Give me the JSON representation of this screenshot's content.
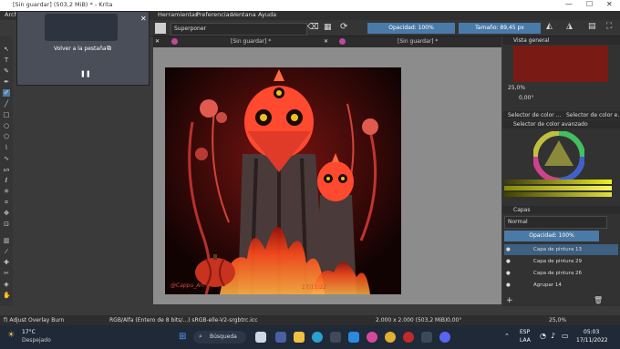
{
  "window": {
    "title": "[Sin guardar] (503,2 MiB) * - Krita"
  },
  "menu": {
    "file": "Archi",
    "tools": "Herramientas",
    "prefs": "Preferencias",
    "window": "Ventana",
    "help": "Ayuda"
  },
  "tool_options": {
    "blend_mode": "Superponer",
    "opacity": "Opacidad: 100%",
    "size": "Tamaño: 89,45 px"
  },
  "tabs": [
    {
      "label": "[Sin guardar] *"
    },
    {
      "label": "[Sin guardar] *"
    }
  ],
  "video_overlay": {
    "back_to_tab": "Volver a la pestaña",
    "pause": "❚❚",
    "close": "✕"
  },
  "artwork": {
    "signature": "@Cappu_Art",
    "date": "17/11/22"
  },
  "dock": {
    "overview_title": "Vista general",
    "zoom_value": "25,0%",
    "rotation_value": "0,00°",
    "selector_tab1": "Selector de color ...",
    "selector_tab2": "Selector de color e...",
    "advanced_selector": "Selector de color avanzado",
    "layers_title": "Capas",
    "layer_blend": "Normal",
    "layer_opacity": "Opacidad: 100%",
    "layers": [
      {
        "name": "Capa de pintura 13"
      },
      {
        "name": "Capa de pintura 29"
      },
      {
        "name": "Capa de pintura 26"
      },
      {
        "name": "Agrupar 14"
      }
    ]
  },
  "status": {
    "brush": "f) Adjust Overlay Burn",
    "color_profile": "RGB/Alfa (Entero de 8 bits/...)  sRGB-elle-V2-srgbtrc.icc",
    "dimensions": "2.000 x 2.000 (503,2 MiB)",
    "rotation": "0,00°",
    "zoom": "25,0%"
  },
  "taskbar": {
    "temperature": "17°C",
    "weather": "Despejado",
    "search": "Búsqueda",
    "lang1": "ESP",
    "lang2": "LAA",
    "time": "05:03",
    "date": "17/11/2022"
  }
}
